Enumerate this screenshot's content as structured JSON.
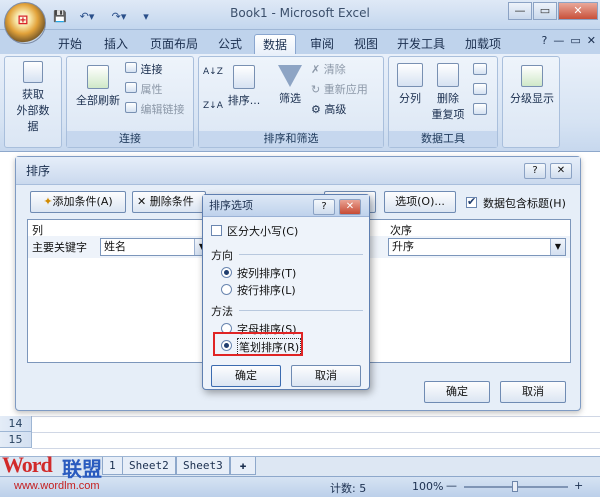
{
  "window": {
    "title": "Book1 - Microsoft Excel",
    "minimize": "—",
    "restore": "▭",
    "close": "✕"
  },
  "qat": {
    "save": "💾",
    "undo": "↶▾",
    "redo": "↷▾",
    "customize": "▾"
  },
  "tabs": [
    "开始",
    "插入",
    "页面布局",
    "公式",
    "数据",
    "审阅",
    "视图",
    "开发工具",
    "加载项"
  ],
  "active_tab": "数据",
  "ribbon_controls": {
    "help": "?",
    "min": "—",
    "restore": "▭",
    "close": "✕"
  },
  "ribbon": {
    "get_external": {
      "line1": "获取",
      "line2": "外部数据"
    },
    "connections": {
      "refresh_all": "全部刷新",
      "connect": "连接",
      "properties": "属性",
      "edit_links": "编辑链接",
      "label": "连接"
    },
    "sort_filter": {
      "sort_az": "A↓Z",
      "sort_za": "Z↓A",
      "sort": "排序...",
      "filter": "筛选",
      "clear": "清除",
      "reapply": "重新应用",
      "advanced": "高级",
      "label": "排序和筛选"
    },
    "data_tools": {
      "text_to_columns": "分列",
      "remove_dup_1": "删除",
      "remove_dup_2": "重复项",
      "label": "数据工具"
    },
    "outline": {
      "label": "分级显示"
    }
  },
  "rows": [
    "14",
    "15"
  ],
  "sheet_tabs": [
    "1",
    "Sheet2",
    "Sheet3"
  ],
  "status": {
    "count": "计数: 5",
    "zoom": "100%",
    "minus": "—",
    "plus": "+"
  },
  "watermark": {
    "word": "Word",
    "league": "联盟",
    "url": "www.wordlm.com"
  },
  "sort_dialog": {
    "title": "排序",
    "help": "?",
    "close": "✕",
    "add_level": "添加条件(A)",
    "delete_level": "删除条件",
    "options": "选项(O)...",
    "header_checkbox_label": "数据包含标题(H)",
    "col_header": "列",
    "order_header": "次序",
    "row_label": "主要关键字",
    "key_value": "姓名",
    "order_value": "升序",
    "ok": "确定",
    "cancel": "取消"
  },
  "options_dialog": {
    "title": "排序选项",
    "help": "?",
    "close": "✕",
    "case_sensitive": "区分大小写(C)",
    "direction_label": "方向",
    "by_column": "按列排序(T)",
    "by_row": "按行排序(L)",
    "method_label": "方法",
    "letter_sort": "字母排序(S)",
    "stroke_sort": "笔划排序(R)",
    "ok": "确定",
    "cancel": "取消"
  },
  "colors": {
    "accent": "#bfd3ec",
    "highlight": "#e02424"
  }
}
